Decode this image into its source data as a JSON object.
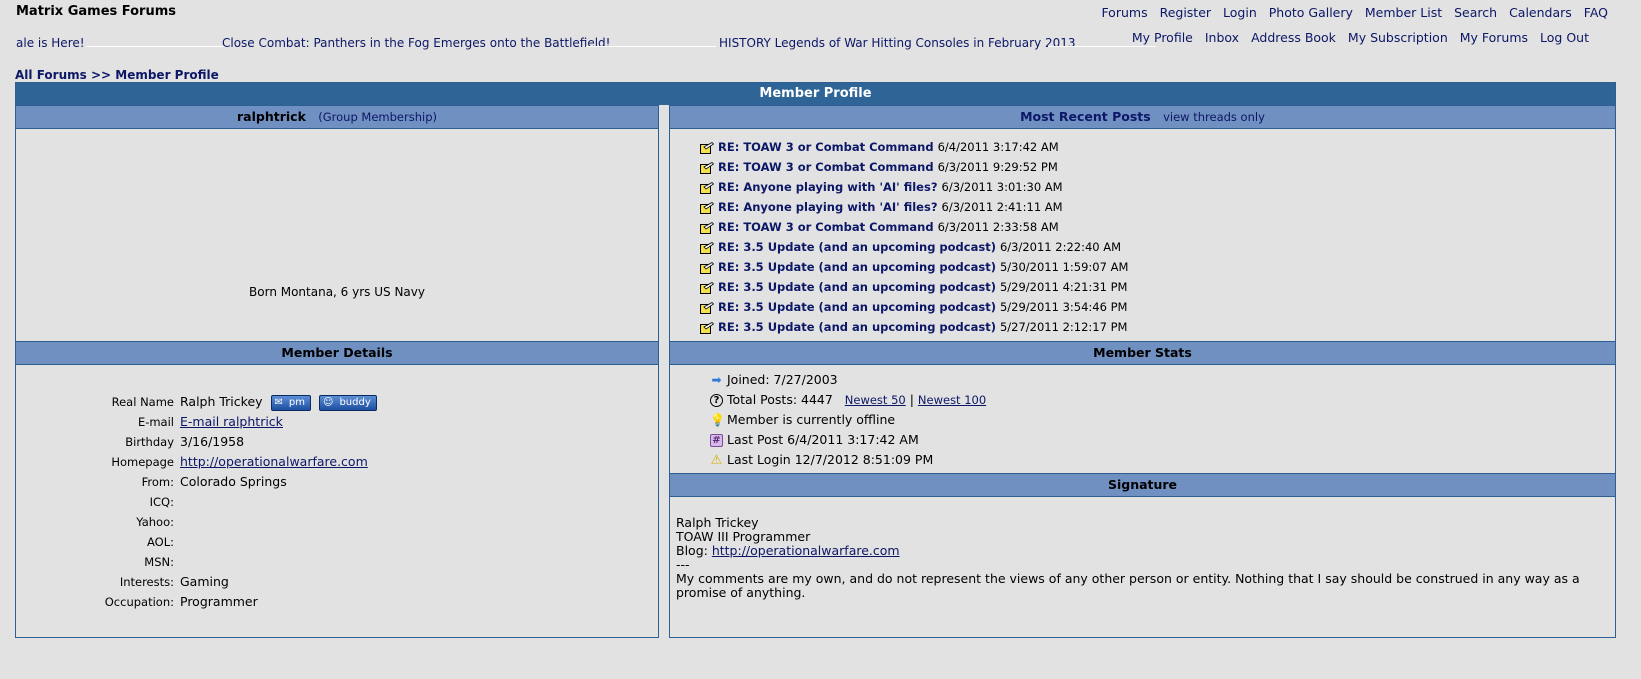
{
  "site": {
    "title": "Matrix Games Forums"
  },
  "top_nav": [
    "Forums",
    "Register",
    "Login",
    "Photo Gallery",
    "Member List",
    "Search",
    "Calendars",
    "FAQ"
  ],
  "user_nav": [
    "My Profile",
    "Inbox",
    "Address Book",
    "My Subscription",
    "My Forums",
    "Log Out"
  ],
  "ticker": [
    "ale is Here!",
    "Close Combat: Panthers in the Fog Emerges onto the Battlefield!",
    "HISTORY Legends of War Hitting Consoles in February 2013"
  ],
  "breadcrumb": {
    "link": "All Forums",
    "separator": ">>",
    "current": "Member Profile"
  },
  "profile": {
    "header": "Member Profile",
    "username": "ralphtrick",
    "group_link": "Group Membership",
    "bio": "Born Montana, 6 yrs US Navy"
  },
  "recent_posts": {
    "title": "Most Recent Posts",
    "view_threads": "view threads only",
    "items": [
      {
        "title": "RE: TOAW 3 or Combat Command",
        "date": "6/4/2011 3:17:42 AM"
      },
      {
        "title": "RE: TOAW 3 or Combat Command",
        "date": "6/3/2011 9:29:52 PM"
      },
      {
        "title": "RE: Anyone playing with 'AI' files?",
        "date": "6/3/2011 3:01:30 AM"
      },
      {
        "title": "RE: Anyone playing with 'AI' files?",
        "date": "6/3/2011 2:41:11 AM"
      },
      {
        "title": "RE: TOAW 3 or Combat Command",
        "date": "6/3/2011 2:33:58 AM"
      },
      {
        "title": "RE: 3.5 Update (and an upcoming podcast)",
        "date": "6/3/2011 2:22:40 AM"
      },
      {
        "title": "RE: 3.5 Update (and an upcoming podcast)",
        "date": "5/30/2011 1:59:07 AM"
      },
      {
        "title": "RE: 3.5 Update (and an upcoming podcast)",
        "date": "5/29/2011 4:21:31 PM"
      },
      {
        "title": "RE: 3.5 Update (and an upcoming podcast)",
        "date": "5/29/2011 3:54:46 PM"
      },
      {
        "title": "RE: 3.5 Update (and an upcoming podcast)",
        "date": "5/27/2011 2:12:17 PM"
      }
    ]
  },
  "member_details": {
    "title": "Member Details",
    "pm_label": "pm",
    "buddy_label": "buddy",
    "rows": [
      {
        "label": "Real Name",
        "value": "Ralph Trickey"
      },
      {
        "label": "E-mail",
        "value": "E-mail ralphtrick"
      },
      {
        "label": "Birthday",
        "value": "3/16/1958"
      },
      {
        "label": "Homepage",
        "value": "http://operationalwarfare.com"
      },
      {
        "label": "From:",
        "value": "Colorado Springs"
      },
      {
        "label": "ICQ:",
        "value": ""
      },
      {
        "label": "Yahoo:",
        "value": ""
      },
      {
        "label": "AOL:",
        "value": ""
      },
      {
        "label": "MSN:",
        "value": ""
      },
      {
        "label": "Interests:",
        "value": "Gaming"
      },
      {
        "label": "Occupation:",
        "value": "Programmer"
      }
    ]
  },
  "member_stats": {
    "title": "Member Stats",
    "joined": "Joined: 7/27/2003",
    "total_posts": "Total Posts: 4447",
    "newest_50": "Newest 50",
    "stats_separator": "|",
    "newest_100": "Newest 100",
    "online_status": "Member is currently offline",
    "last_post": "Last Post 6/4/2011 3:17:42 AM",
    "last_login": "Last Login 12/7/2012 8:51:09 PM"
  },
  "signature": {
    "title": "Signature",
    "line1": "Ralph Trickey",
    "line2": "TOAW III Programmer",
    "blog_label": "Blog:",
    "blog_link": "http://operationalwarfare.com",
    "line4": "---",
    "line5": "My comments are my own, and do not represent the views of any other person or entity. Nothing that I say should be construed in any way as a promise of anything."
  },
  "colors": {
    "page_bg": "#e2e2e2",
    "header_bar": "#2f6497",
    "section_bar": "#7090c2",
    "link": "#0c1766"
  }
}
